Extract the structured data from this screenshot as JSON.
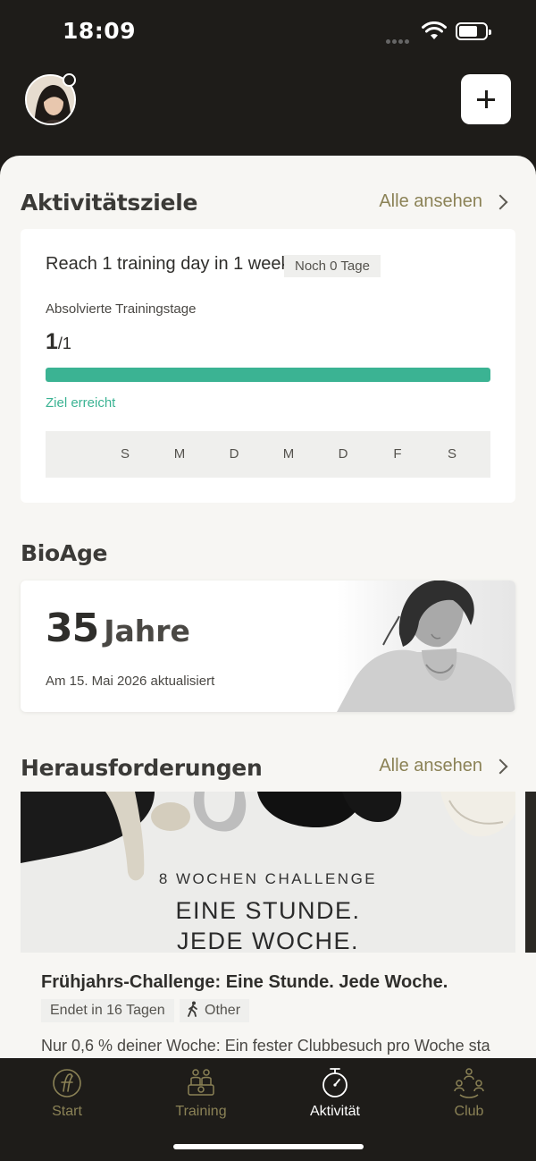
{
  "status": {
    "time": "18:09"
  },
  "goals": {
    "title": "Aktivitätsziele",
    "see_all": "Alle ansehen",
    "goal_title": "Reach 1 training day in 1 week",
    "badge": "Noch 0 Tage",
    "subtitle": "Absolvierte Trainingstage",
    "count": "1",
    "total": "/1",
    "progress": 1.0,
    "status": "Ziel erreicht",
    "days": [
      "S",
      "M",
      "D",
      "M",
      "D",
      "F",
      "S"
    ]
  },
  "bioage": {
    "title": "BioAge",
    "value": "35",
    "unit": "Jahre",
    "updated": "Am 15. Mai 2026 aktualisiert"
  },
  "challenges": {
    "title": "Herausforderungen",
    "see_all": "Alle ansehen",
    "image_overline": "8 WOCHEN CHALLENGE",
    "image_line1": "EINE STUNDE.",
    "image_line2": "JEDE WOCHE.",
    "name": "Frühjahrs-Challenge: Eine Stunde. Jede Woche.",
    "ends": "Endet in 16 Tagen",
    "type": "Other",
    "description": "Nur 0,6 % deiner Woche: Ein fester Clubbesuch pro Woche sta"
  },
  "tabs": [
    {
      "label": "Start",
      "icon": "start-logo-icon"
    },
    {
      "label": "Training",
      "icon": "training-icon"
    },
    {
      "label": "Aktivität",
      "icon": "stopwatch-icon"
    },
    {
      "label": "Club",
      "icon": "club-people-icon"
    }
  ],
  "colors": {
    "accent": "#3bb393",
    "gold": "#8b8256",
    "dark": "#1e1c19"
  }
}
